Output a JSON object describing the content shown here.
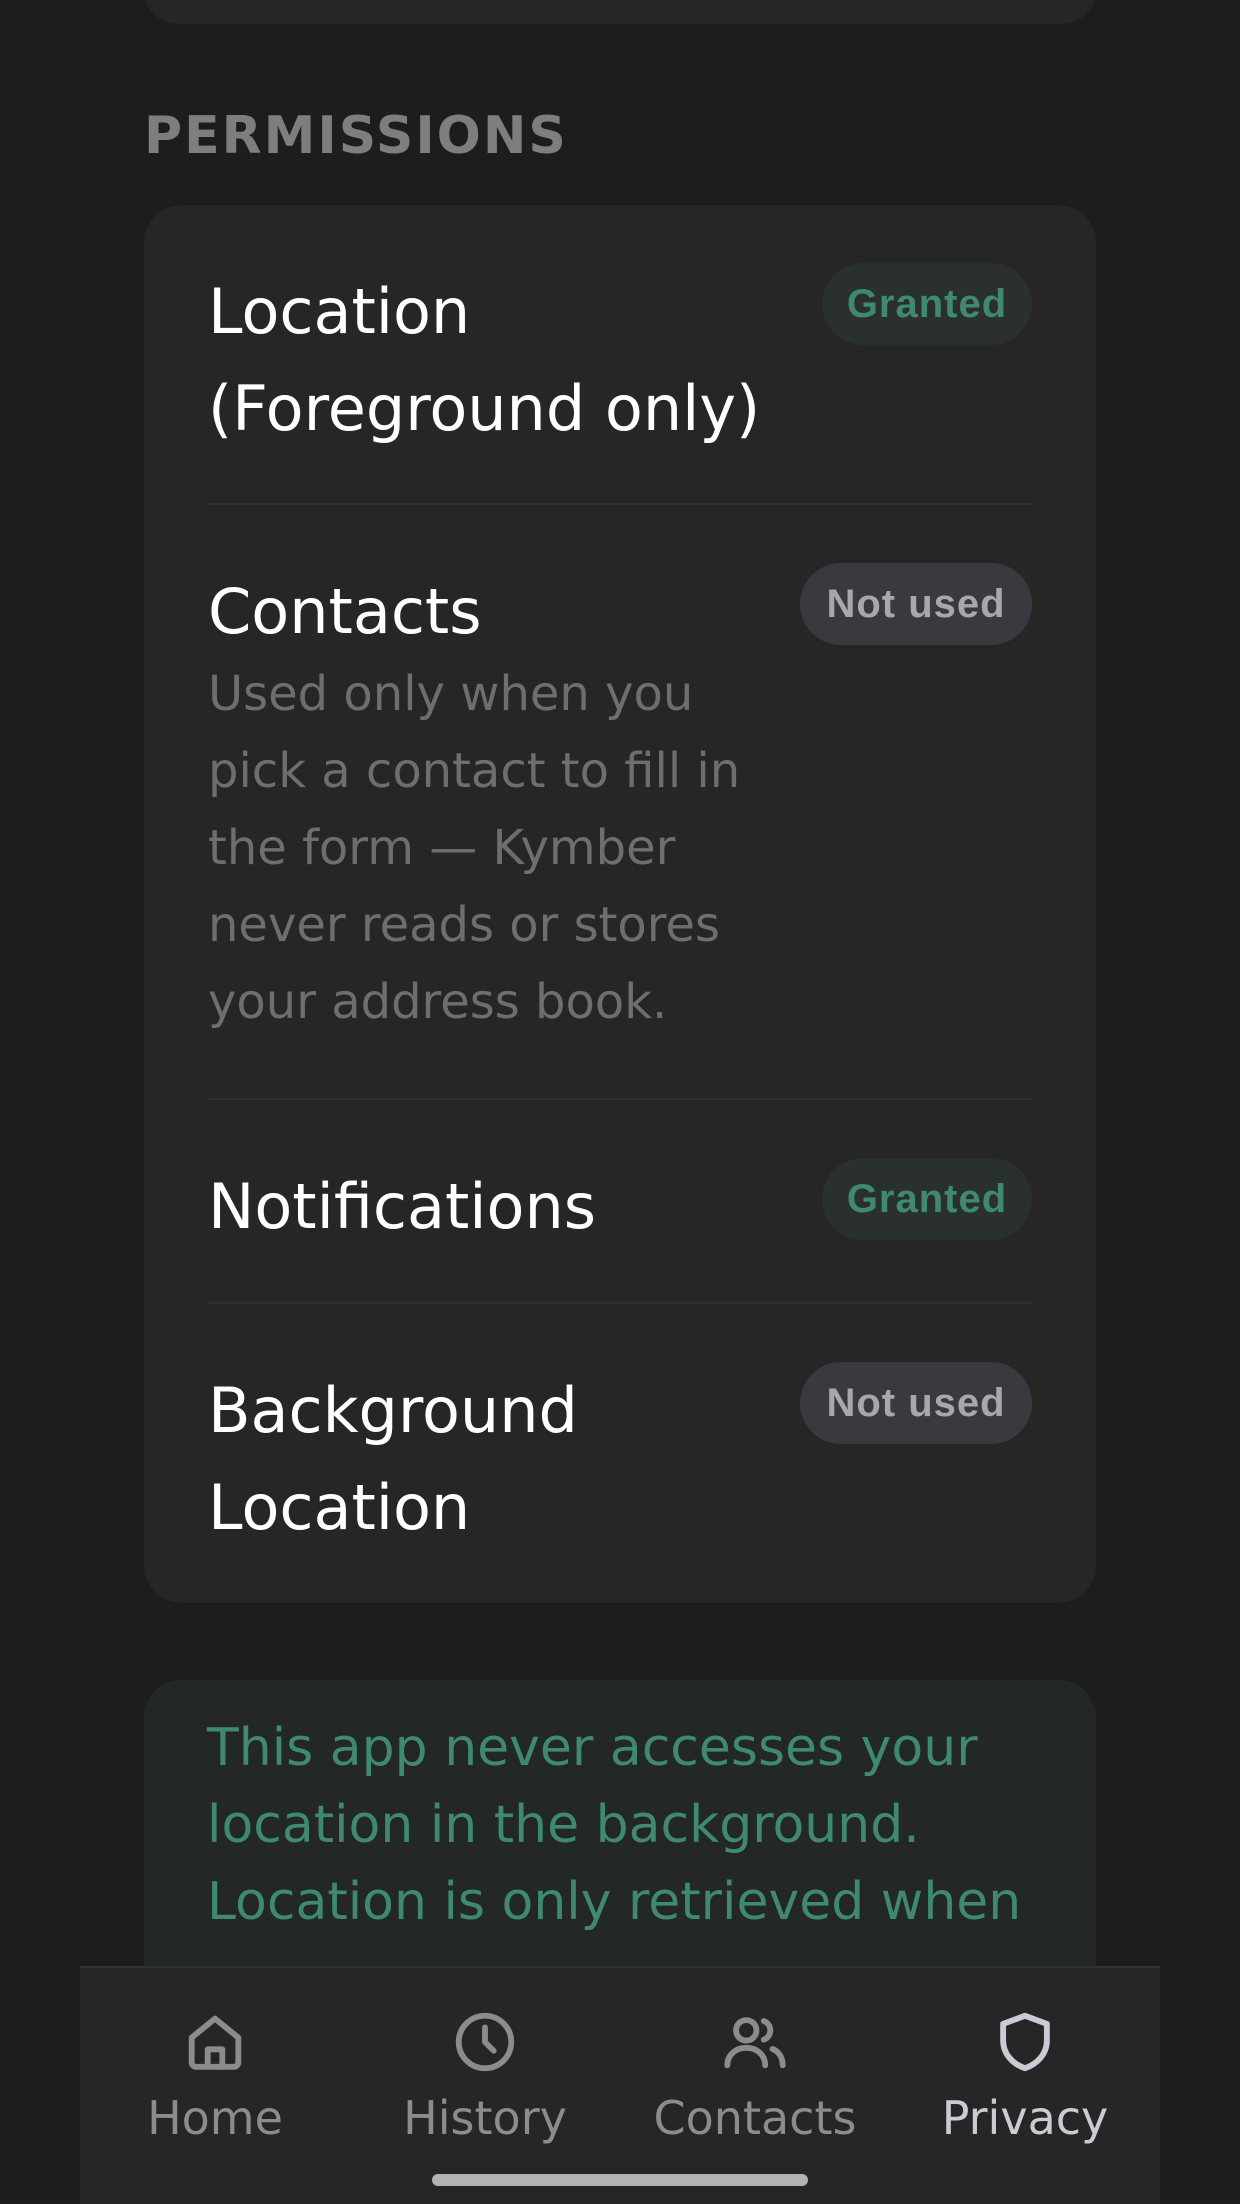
{
  "permissions": {
    "section_title": "PERMISSIONS",
    "items": [
      {
        "name_line1": "Location",
        "name_line2": "(Foreground only)",
        "status": "Granted"
      },
      {
        "name_line1": "Contacts",
        "description": [
          "Used only when you",
          "pick a contact to fill in",
          "the form — Kymber",
          "never reads or stores",
          "your address book."
        ],
        "status": "Not used"
      },
      {
        "name_line1": "Notifications",
        "status": "Granted"
      },
      {
        "name_line1": "Background",
        "name_line2": "Location",
        "status": "Not used"
      }
    ]
  },
  "info_notice": {
    "lines": [
      "This app never accesses your",
      "location in the background.",
      "Location is only retrieved when"
    ]
  },
  "tabbar": {
    "tabs": [
      {
        "label": "Home",
        "icon": "home-icon",
        "active": false
      },
      {
        "label": "History",
        "icon": "clock-icon",
        "active": false
      },
      {
        "label": "Contacts",
        "icon": "users-icon",
        "active": false
      },
      {
        "label": "Privacy",
        "icon": "shield-icon",
        "active": true
      }
    ]
  },
  "colors": {
    "background": "#1d1d1d",
    "card": "#262626",
    "granted_text": "#3f8a6e",
    "granted_bg": "#2a302d",
    "not_used_text": "#a7a7ad",
    "not_used_bg": "#3a3940",
    "notice_bg": "#232725",
    "notice_text": "#3f8a6e",
    "active_tab": "#c9ccd4",
    "inactive_tab": "#8c8c8c"
  }
}
